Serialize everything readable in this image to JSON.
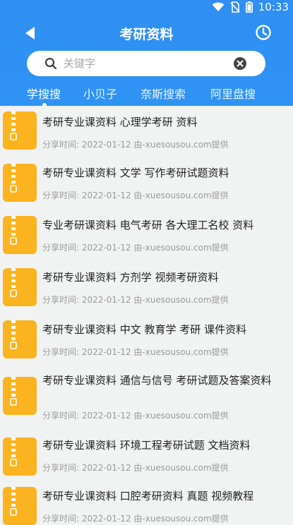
{
  "status_bar": {
    "time": "10:33",
    "icons": [
      "wifi-icon",
      "no-sim-icon",
      "battery-icon"
    ]
  },
  "header": {
    "title": "考研资料",
    "back_icon": "back-arrow-icon",
    "history_icon": "clock-icon"
  },
  "search": {
    "placeholder": "关键字",
    "value": "",
    "search_icon": "search-icon",
    "clear_icon": "clear-icon"
  },
  "tabs": [
    {
      "label": "学搜搜",
      "active": true
    },
    {
      "label": "小贝子",
      "active": false
    },
    {
      "label": "奈斯搜索",
      "active": false
    },
    {
      "label": "阿里盘搜",
      "active": false
    }
  ],
  "colors": {
    "header_blue": "#2f8ff2",
    "file_icon_orange": "#fbb41f",
    "background": "#f1f2f2"
  },
  "results": [
    {
      "title": "考研专业课资料 心理学考研 资料",
      "meta": "分享时间: 2022-01-12  由-xuesousou.com提供"
    },
    {
      "title": "考研专业课资料 文学 写作考研试题资料",
      "meta": "分享时间: 2022-01-12  由-xuesousou.com提供"
    },
    {
      "title": "专业考研课资料 电气考研 各大理工名校 资料",
      "meta": "分享时间: 2022-01-12  由-xuesousou.com提供"
    },
    {
      "title": "考研专业课资料 方剂学 视频考研资料",
      "meta": "分享时间: 2022-01-12  由-xuesousou.com提供"
    },
    {
      "title": "考研专业课资料 中文 教育学 考研 课件资料",
      "meta": "分享时间: 2022-01-12  由-xuesousou.com提供"
    },
    {
      "title": "考研专业课资料 通信与信号 考研试题及答案资料",
      "meta": "分享时间: 2022-01-12  由-xuesousou.com提供"
    },
    {
      "title": "考研专业课资料 环境工程考研试题 文档资料",
      "meta": "分享时间: 2022-01-12  由-xuesousou.com提供"
    },
    {
      "title": "考研专业课资料 口腔考研资料 真题 视频教程",
      "meta": "分享时间: 2022-01-12  由-xuesousou.com提供"
    }
  ]
}
